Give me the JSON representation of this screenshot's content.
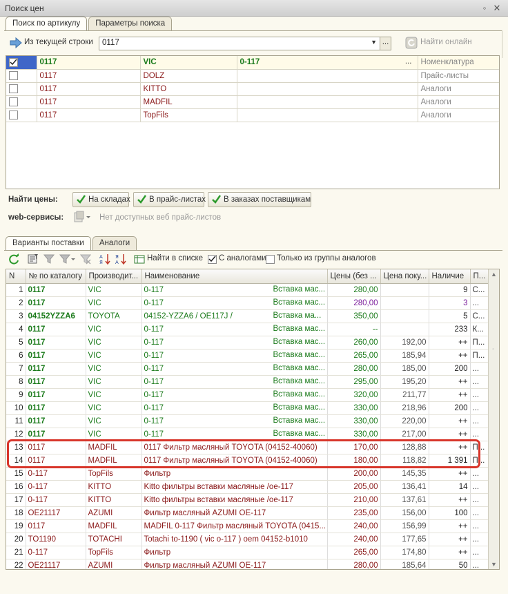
{
  "window": {
    "title": "Поиск цен"
  },
  "top_tabs": [
    {
      "label": "Поиск по артикулу",
      "active": true
    },
    {
      "label": "Параметры поиска",
      "active": false
    }
  ],
  "search": {
    "from_row_label": "Из текущей строки",
    "value": "0117",
    "find_online_label": "Найти онлайн"
  },
  "top_rows": [
    {
      "checked": true,
      "article": "0117",
      "brand": "VIC",
      "name": "0-117",
      "extra": "...",
      "type": "Номенклатура"
    },
    {
      "checked": false,
      "article": "0117",
      "brand": "DOLZ",
      "name": "",
      "extra": "",
      "type": "Прайс-листы"
    },
    {
      "checked": false,
      "article": "0117",
      "brand": "KITTO",
      "name": "",
      "extra": "",
      "type": "Аналоги"
    },
    {
      "checked": false,
      "article": "0117",
      "brand": "MADFIL",
      "name": "",
      "extra": "",
      "type": "Аналоги"
    },
    {
      "checked": false,
      "article": "0117",
      "brand": "TopFils",
      "name": "",
      "extra": "",
      "type": "Аналоги"
    }
  ],
  "find_prices": {
    "label": "Найти цены:",
    "buttons": [
      "На складах",
      "В прайс-листах",
      "В заказах поставщикам"
    ]
  },
  "web_services": {
    "label": "web-сервисы:",
    "status": "Нет доступных веб прайс-листов"
  },
  "bottom_tabs": [
    {
      "label": "Варианты поставки",
      "active": true
    },
    {
      "label": "Аналоги",
      "active": false
    }
  ],
  "toolbar": {
    "find_in_list": "Найти в списке",
    "with_analogs": "С аналогами",
    "only_group": "Только из группы аналогов"
  },
  "grid": {
    "headers": [
      "N",
      "№ по каталогу",
      "Производит...",
      "Наименование",
      "Цены (без ...",
      "Цена поку...",
      "Наличие",
      "П..."
    ],
    "rows": [
      {
        "n": "1",
        "cat": "0117",
        "mfr": "VIC",
        "name": "0-117",
        "name2": "Вставка мас...",
        "price": "280,00",
        "buy": "",
        "stock": "9",
        "p": "С...",
        "style": "g"
      },
      {
        "n": "2",
        "cat": "0117",
        "mfr": "VIC",
        "name": "0-117",
        "name2": "Вставка мас...",
        "price": "280,00",
        "buy": "",
        "stock": "3",
        "p": "...",
        "style": "g",
        "pur": true
      },
      {
        "n": "3",
        "cat": "04152YZZA6",
        "mfr": "TOYOTA",
        "name": "04152-YZZA6 / OE117J /",
        "name2": "Вставка ма...",
        "price": "350,00",
        "buy": "",
        "stock": "5",
        "p": "С...",
        "style": "g"
      },
      {
        "n": "4",
        "cat": "0117",
        "mfr": "VIC",
        "name": "0-117",
        "name2": "Вставка мас...",
        "price": "--",
        "buy": "",
        "stock": "233",
        "p": "К...",
        "style": "g"
      },
      {
        "n": "5",
        "cat": "0117",
        "mfr": "VIC",
        "name": "0-117",
        "name2": "Вставка мас...",
        "price": "260,00",
        "buy": "192,00",
        "stock": "++",
        "p": "П...",
        "style": "g"
      },
      {
        "n": "6",
        "cat": "0117",
        "mfr": "VIC",
        "name": "0-117",
        "name2": "Вставка мас...",
        "price": "265,00",
        "buy": "185,94",
        "stock": "++",
        "p": "П...",
        "style": "g"
      },
      {
        "n": "7",
        "cat": "0117",
        "mfr": "VIC",
        "name": "0-117",
        "name2": "Вставка мас...",
        "price": "280,00",
        "buy": "185,00",
        "stock": "200",
        "p": "...",
        "style": "g"
      },
      {
        "n": "8",
        "cat": "0117",
        "mfr": "VIC",
        "name": "0-117",
        "name2": "Вставка мас...",
        "price": "295,00",
        "buy": "195,20",
        "stock": "++",
        "p": "...",
        "style": "g"
      },
      {
        "n": "9",
        "cat": "0117",
        "mfr": "VIC",
        "name": "0-117",
        "name2": "Вставка мас...",
        "price": "320,00",
        "buy": "211,77",
        "stock": "++",
        "p": "...",
        "style": "g"
      },
      {
        "n": "10",
        "cat": "0117",
        "mfr": "VIC",
        "name": "0-117",
        "name2": "Вставка мас...",
        "price": "330,00",
        "buy": "218,96",
        "stock": "200",
        "p": "...",
        "style": "g"
      },
      {
        "n": "11",
        "cat": "0117",
        "mfr": "VIC",
        "name": "0-117",
        "name2": "Вставка мас...",
        "price": "330,00",
        "buy": "220,00",
        "stock": "++",
        "p": "...",
        "style": "g"
      },
      {
        "n": "12",
        "cat": "0117",
        "mfr": "VIC",
        "name": "0-117",
        "name2": "Вставка мас...",
        "price": "330,00",
        "buy": "217,00",
        "stock": "++",
        "p": "...",
        "style": "g"
      },
      {
        "n": "13",
        "cat": "0117",
        "mfr": "MADFIL",
        "name": "0117 Фильтр масляный TOYOTA (04152-40060)",
        "name2": "",
        "price": "170,00",
        "buy": "128,88",
        "stock": "++",
        "p": "П...",
        "style": "r"
      },
      {
        "n": "14",
        "cat": "0117",
        "mfr": "MADFIL",
        "name": "0117 Фильтр масляный TOYOTA (04152-40060)",
        "name2": "",
        "price": "180,00",
        "buy": "118,82",
        "stock": "1 391",
        "p": "П...",
        "style": "r"
      },
      {
        "n": "15",
        "cat": "0-117",
        "mfr": "TopFils",
        "name": "Фильтр",
        "name2": "",
        "price": "200,00",
        "buy": "145,35",
        "stock": "++",
        "p": "...",
        "style": "r"
      },
      {
        "n": "16",
        "cat": "0-117",
        "mfr": "KITTO",
        "name": "Kitto фильтры вставки масляные /oe-117",
        "name2": "",
        "price": "205,00",
        "buy": "136,41",
        "stock": "14",
        "p": "...",
        "style": "r"
      },
      {
        "n": "17",
        "cat": "0-117",
        "mfr": "KITTO",
        "name": "Kitto фильтры вставки масляные /oe-117",
        "name2": "",
        "price": "210,00",
        "buy": "137,61",
        "stock": "++",
        "p": "...",
        "style": "r"
      },
      {
        "n": "18",
        "cat": "OE21117",
        "mfr": "AZUMI",
        "name": "Фильтр масляный AZUMI OE-117",
        "name2": "",
        "price": "235,00",
        "buy": "156,00",
        "stock": "100",
        "p": "...",
        "style": "r"
      },
      {
        "n": "19",
        "cat": "0117",
        "mfr": "MADFIL",
        "name": " MADFIL 0-117 Фильтр масляный TOYOTA (0415...",
        "name2": "",
        "price": "240,00",
        "buy": "156,99",
        "stock": "++",
        "p": "...",
        "style": "r"
      },
      {
        "n": "20",
        "cat": "TO1190",
        "mfr": "TOTACHI",
        "name": "Totachi to-1190 ( vic o-117 ) oem 04152-b1010",
        "name2": "",
        "price": "240,00",
        "buy": "177,65",
        "stock": "++",
        "p": "...",
        "style": "r"
      },
      {
        "n": "21",
        "cat": "0-117",
        "mfr": "TopFils",
        "name": "Фильтр",
        "name2": "",
        "price": "265,00",
        "buy": "174,80",
        "stock": "++",
        "p": "...",
        "style": "r"
      },
      {
        "n": "22",
        "cat": "OE21117",
        "mfr": "AZUMI",
        "name": "Фильтр масляный AZUMI OE-117",
        "name2": "",
        "price": "280,00",
        "buy": "185,64",
        "stock": "50",
        "p": "...",
        "style": "r"
      }
    ]
  },
  "colors": {
    "green": "#1a7a1a",
    "red": "#8b1a1a",
    "highlight": "#d8352a",
    "check": "#2c9a2c"
  }
}
